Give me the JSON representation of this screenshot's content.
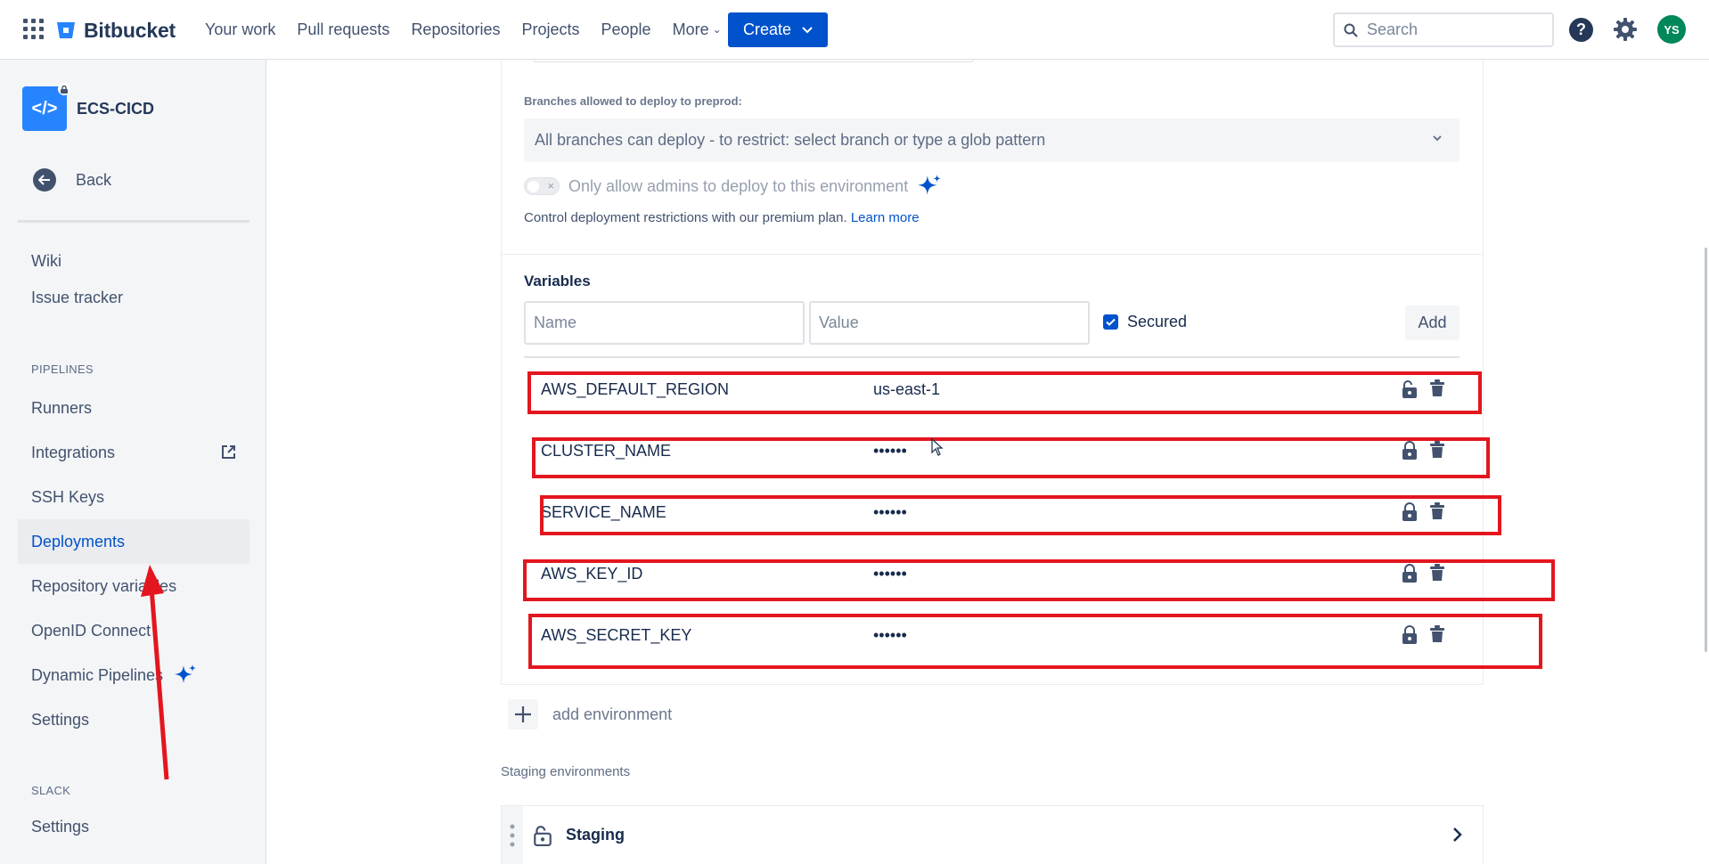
{
  "topnav": {
    "brand": "Bitbucket",
    "links": [
      "Your work",
      "Pull requests",
      "Repositories",
      "Projects",
      "People",
      "More"
    ],
    "create_label": "Create",
    "search_placeholder": "Search",
    "help_glyph": "?",
    "avatar_initials": "YS",
    "avatar_color": "#00875a",
    "accent_color": "#0052cc"
  },
  "sidebar": {
    "repo_name": "ECS-CICD",
    "repo_icon_glyph": "</>",
    "back_label": "Back",
    "items_top": [
      "Wiki",
      "Issue tracker"
    ],
    "section_pipelines": "PIPELINES",
    "pipelines_items": [
      "Runners",
      "Integrations",
      "SSH Keys",
      "Deployments",
      "Repository variables",
      "OpenID Connect",
      "Dynamic Pipelines",
      "Settings"
    ],
    "active_item": "Deployments",
    "section_slack": "SLACK",
    "slack_items": [
      "Settings"
    ]
  },
  "environment": {
    "branches_label": "Branches allowed to deploy to preprod:",
    "branches_select_value": "All branches can deploy - to restrict: select branch or type a glob pattern",
    "admin_toggle_label": "Only allow admins to deploy to this environment",
    "admin_toggle_on": false,
    "restrict_text": "Control deployment restrictions with our premium plan.",
    "learn_more": "Learn more"
  },
  "variables": {
    "title": "Variables",
    "name_placeholder": "Name",
    "value_placeholder": "Value",
    "secured_label": "Secured",
    "secured_checked": true,
    "add_label": "Add",
    "rows": [
      {
        "name": "AWS_DEFAULT_REGION",
        "value": "us-east-1",
        "secured": false
      },
      {
        "name": "CLUSTER_NAME",
        "value": "••••••",
        "secured": true
      },
      {
        "name": "SERVICE_NAME",
        "value": "••••••",
        "secured": true
      },
      {
        "name": "AWS_KEY_ID",
        "value": "••••••",
        "secured": true
      },
      {
        "name": "AWS_SECRET_KEY",
        "value": "••••••",
        "secured": true
      }
    ]
  },
  "add_environment_label": "add environment",
  "staging": {
    "section_title": "Staging environments",
    "env_name": "Staging"
  },
  "annotation_color": "#e3161e"
}
